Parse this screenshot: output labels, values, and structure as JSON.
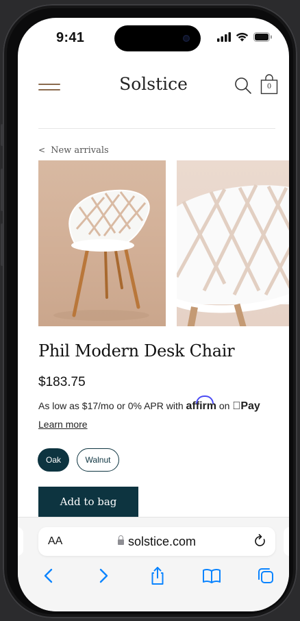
{
  "status_bar": {
    "time": "9:41"
  },
  "header": {
    "brand": "Solstice",
    "bag_count": "0"
  },
  "breadcrumb": {
    "label": "New arrivals"
  },
  "product": {
    "title": "Phil Modern Desk Chair",
    "price": "$183.75",
    "financing_text": "As low as $17/mo or 0% APR with",
    "financing_brand": "affirm",
    "financing_on": "on",
    "financing_pay": "Pay",
    "learn_more": "Learn more",
    "options": [
      {
        "label": "Oak",
        "selected": true
      },
      {
        "label": "Walnut",
        "selected": false
      }
    ],
    "add_to_bag": "Add to bag"
  },
  "browser": {
    "text_size_label": "AA",
    "url": "solstice.com"
  },
  "colors": {
    "accent": "#0d3440",
    "menu_icon": "#8a6a4d",
    "link_blue": "#0a84ff",
    "affirm_blue": "#4a4af4"
  }
}
